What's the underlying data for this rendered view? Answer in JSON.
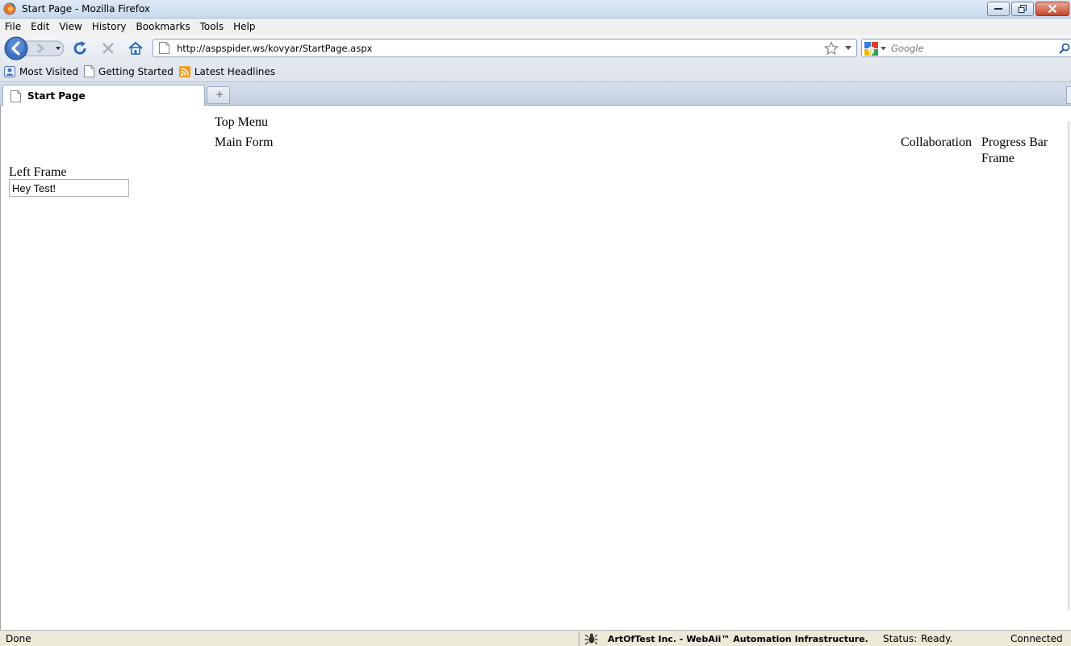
{
  "window": {
    "title": "Start Page - Mozilla Firefox"
  },
  "menu": {
    "items": [
      "File",
      "Edit",
      "View",
      "History",
      "Bookmarks",
      "Tools",
      "Help"
    ]
  },
  "navigation": {
    "url": "http://aspspider.ws/kovyar/StartPage.aspx",
    "search_placeholder": "Google"
  },
  "bookmarks": {
    "items": [
      "Most Visited",
      "Getting Started",
      "Latest Headlines"
    ]
  },
  "tabs": {
    "active_label": "Start Page"
  },
  "page": {
    "top_menu": "Top Menu",
    "main_form": "Main Form",
    "collaboration": "Collaboration",
    "progress_bar_frame_line1": "Progress Bar",
    "progress_bar_frame_line2": "Frame",
    "left_frame": "Left Frame",
    "input_value": "Hey Test!"
  },
  "status": {
    "done": "Done",
    "vendor": "ArtOfTest Inc. -  WebAii™ Automation Infrastructure.",
    "status_label": "Status:",
    "status_value": "Ready.",
    "connection": "Connected"
  }
}
